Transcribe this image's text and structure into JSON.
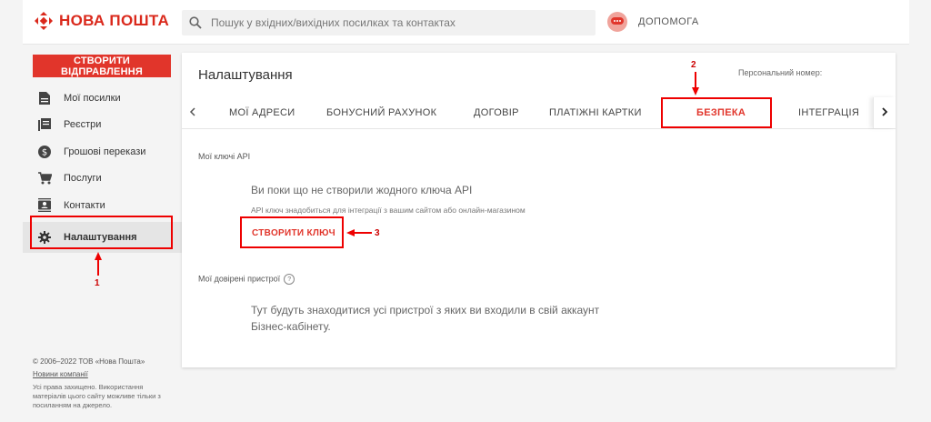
{
  "topbar": {
    "logo_text": "НОВА ПОШТА",
    "search_placeholder": "Пошук у вхідних/вихідних посилках та контактах",
    "help_label": "ДОПОМОГА"
  },
  "sidebar": {
    "create_button": "СТВОРИТИ ВІДПРАВЛЕННЯ",
    "items": [
      {
        "label": "Мої посилки",
        "icon": "document-icon"
      },
      {
        "label": "Реєстри",
        "icon": "registry-icon"
      },
      {
        "label": "Грошові перекази",
        "icon": "money-icon"
      },
      {
        "label": "Послуги",
        "icon": "cart-icon"
      },
      {
        "label": "Контакти",
        "icon": "contacts-icon"
      },
      {
        "label": "Налаштування",
        "icon": "gear-icon"
      }
    ],
    "footer": {
      "copyright": "© 2006–2022 ТОВ «Нова Пошта»",
      "news_link": "Новини компанії",
      "rights": "Усі права захищено. Використання матеріалів цього сайту можливе тільки з посиланням на джерело."
    }
  },
  "main": {
    "title": "Налаштування",
    "personal_number_label": "Персональний номер:",
    "tabs": [
      {
        "label": "МОЇ АДРЕСИ"
      },
      {
        "label": "БОНУСНИЙ РАХУНОК"
      },
      {
        "label": "ДОГОВІР"
      },
      {
        "label": "ПЛАТІЖНІ КАРТКИ"
      },
      {
        "label": "БЕЗПЕКА"
      },
      {
        "label": "ІНТЕГРАЦІЯ"
      }
    ],
    "api_section": {
      "label": "Мої ключі API",
      "empty_title": "Ви поки що не створили жодного ключа API",
      "empty_sub": "API ключ знадобиться для інтеграції з вашим сайтом або онлайн-магазином",
      "create_button": "СТВОРИТИ КЛЮЧ"
    },
    "devices_section": {
      "label": "Мої довірені пристрої",
      "help_glyph": "?",
      "text": "Тут будуть знаходитися усі пристрої з яких ви входили в свій аккаунт Бізнес-кабінету."
    }
  },
  "annotations": [
    "1",
    "2",
    "3"
  ],
  "colors": {
    "brand_red": "#e1352b",
    "annotation_red": "#e00000"
  }
}
